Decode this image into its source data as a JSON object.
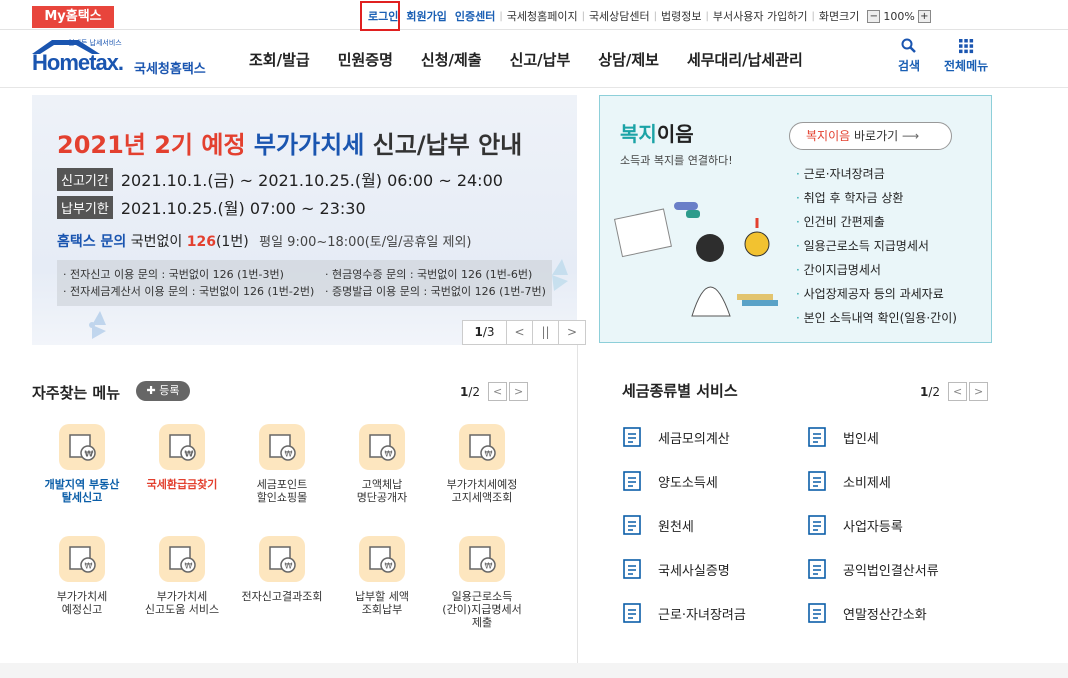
{
  "topbar": {
    "my_hometax": "My홈택스",
    "login": "로그인",
    "signup": "회원가입",
    "cert": "인증센터",
    "links": [
      "국세청홈페이지",
      "국세상담센터",
      "법령정보",
      "부서사용자 가입하기",
      "화면크기"
    ],
    "zoom_minus": "−",
    "zoom_value": "100%",
    "zoom_plus": "+"
  },
  "header": {
    "logo_small": "언제든 납세서비스",
    "logo_main": "Hometax.",
    "logo_sub": "국세청홈택스",
    "nav": [
      "조회/발급",
      "민원증명",
      "신청/제출",
      "신고/납부",
      "상담/제보",
      "세무대리/납세관리"
    ],
    "search_label": "검색",
    "allmenu_label": "전체메뉴"
  },
  "banner": {
    "title_red": "2021년 2기 예정",
    "title_blue": "부가가치세",
    "title_rest": "신고/납부 안내",
    "period_tag": "신고기간",
    "period_text": "2021.10.1.(금) ~ 2021.10.25.(월) 06:00 ~ 24:00",
    "due_tag": "납부기한",
    "due_text": "2021.10.25.(월) 07:00 ~ 23:30",
    "contact_blue": "홈택스 문의",
    "contact_mid": "국번없이",
    "contact_num": "126",
    "contact_tail": "(1번)",
    "contact_hours": "평일 9:00~18:00(토/일/공휴일 제외)",
    "info": [
      "· 전자신고 이용 문의 : 국번없이 126 (1번-3번)",
      "· 현금영수증 문의 : 국번없이 126 (1번-6번)",
      "· 전자세금계산서 이용 문의 : 국번없이 126 (1번-2번)",
      "· 증명발급 이용 문의 : 국번없이 126 (1번-7번)"
    ],
    "page_current": "1",
    "page_total": "/3"
  },
  "welfare": {
    "title_green": "복지",
    "title_rest": "이음",
    "subtitle": "소득과 복지를 연결하다!",
    "go_green": "복지이음",
    "go_rest": "바로가기",
    "items": [
      "근로·자녀장려금",
      "취업 후 학자금 상환",
      "인건비 간편제출",
      "일용근로소득 지급명세서",
      "간이지급명세서",
      "사업장제공자 등의 과세자료",
      "본인 소득내역 확인(일용·간이)"
    ]
  },
  "favorites": {
    "title": "자주찾는 메뉴",
    "register": "등록",
    "page_current": "1",
    "page_total": "/2",
    "items": [
      "개발지역 부동산\n탈세신고",
      "국세환급금찾기",
      "세금포인트\n할인쇼핑몰",
      "고액체납\n명단공개자",
      "부가가치세예정\n고지세액조회",
      "부가가치세\n예정신고",
      "부가가치세\n신고도움 서비스",
      "전자신고결과조회",
      "납부할 세액\n조회납부",
      "일용근로소득\n(간이)지급명세서\n제출"
    ]
  },
  "taxtypes": {
    "title": "세금종류별 서비스",
    "page_current": "1",
    "page_total": "/2",
    "items": [
      "세금모의계산",
      "법인세",
      "양도소득세",
      "소비제세",
      "원천세",
      "사업자등록",
      "국세사실증명",
      "공익법인결산서류",
      "근로·자녀장려금",
      "연말정산간소화"
    ]
  },
  "colors": {
    "red": "#e3402f",
    "blue": "#1a55b0",
    "green": "#1ba3a6"
  }
}
